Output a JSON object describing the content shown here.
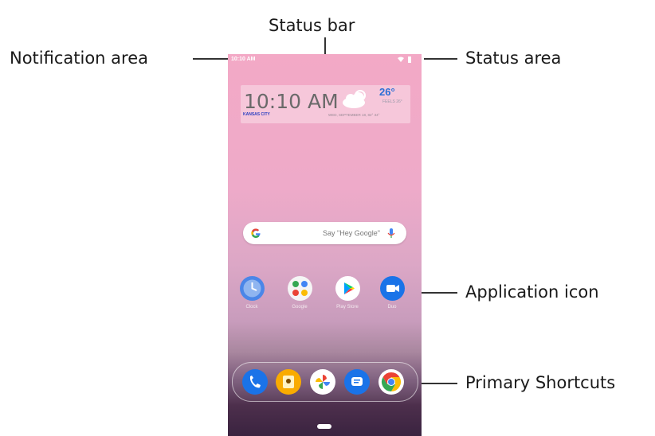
{
  "callouts": {
    "status_bar": "Status bar",
    "notification_area": "Notification area",
    "status_area": "Status area",
    "application_icon": "Application icon",
    "primary_shortcuts": "Primary Shortcuts"
  },
  "screen": {
    "status_time": "10:10 AM",
    "clock_widget": {
      "time": "10:10 AM",
      "temperature": "26°",
      "feels_like": "FEELS 26°",
      "city": "KANSAS CITY",
      "date": "WED, SEPTEMBER 18, 82° 34°"
    },
    "search": {
      "placeholder": "Say \"Hey Google\""
    },
    "apps": [
      {
        "label": "Clock",
        "icon": "clock-icon"
      },
      {
        "label": "Google",
        "icon": "google-folder-icon"
      },
      {
        "label": "Play Store",
        "icon": "play-store-icon"
      },
      {
        "label": "Duo",
        "icon": "duo-icon"
      }
    ],
    "dock": [
      {
        "icon": "phone-icon"
      },
      {
        "icon": "contacts-icon"
      },
      {
        "icon": "photos-icon"
      },
      {
        "icon": "messages-icon"
      },
      {
        "icon": "chrome-icon"
      }
    ]
  },
  "colors": {
    "wallpaper_top": "#f3a9c6",
    "wallpaper_bottom": "#3a2340",
    "accent_blue": "#2b6fd6"
  }
}
